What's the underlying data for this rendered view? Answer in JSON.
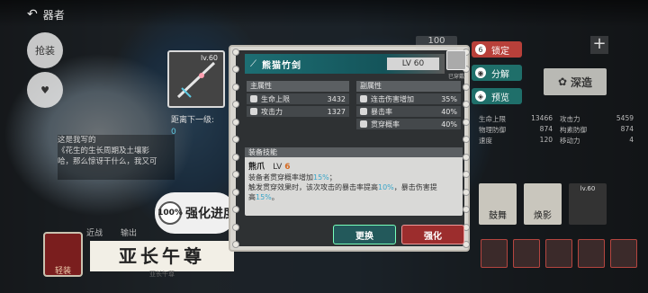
{
  "nav": {
    "back_label": "器者"
  },
  "sidebar": {
    "item1_label": "抢装",
    "item2_label": "装备"
  },
  "bio": {
    "lines": [
      "这是我写的",
      "《花生的生长周期及土壤影",
      "哈，那么惊讶干什么，我又可"
    ]
  },
  "bottom_tabs": [
    "近战",
    "输出"
  ],
  "character": {
    "name": "亚长午尊",
    "subtitle": "亚长午尊",
    "badge_label": "轻装"
  },
  "weapon_card": {
    "level": "lv.60"
  },
  "distance": {
    "label": "距离下一级:",
    "value": "0"
  },
  "enhance_progress": {
    "percent": "100",
    "unit": "%",
    "label": "强化进度"
  },
  "weapon": {
    "name": "熊猫竹剑",
    "level": "LV 60",
    "equipped_label": "已穿戴"
  },
  "main_attrs": {
    "title": "主属性",
    "rows": [
      {
        "label": "生命上限",
        "value": "3432"
      },
      {
        "label": "攻击力",
        "value": "1327"
      }
    ]
  },
  "sub_attrs": {
    "title": "副属性",
    "rows": [
      {
        "label": "连击伤害增加",
        "value": "35%"
      },
      {
        "label": "暴击率",
        "value": "40%"
      },
      {
        "label": "贯穿概率",
        "value": "40%"
      }
    ]
  },
  "skill": {
    "section_title": "装备技能",
    "name": "熊爪",
    "level_prefix": "LV",
    "level": "6",
    "line1a": "装备者贯穿概率增加",
    "line1b": "15%",
    "line1c": "；",
    "line2a": "触发贯穿效果时，该次攻击的暴击率提高",
    "line2b": "10%",
    "line2c": "，暴击伤害提",
    "line3a": "高",
    "line3b": "15%",
    "line3c": "。"
  },
  "buttons": {
    "change": "更换",
    "strengthen": "强化"
  },
  "side_actions": [
    {
      "label": "锁定",
      "icon": "lock-icon",
      "color": "#b8403a"
    },
    {
      "label": "分解",
      "icon": "eye-icon",
      "color": "#1f6f6a"
    },
    {
      "label": "预览",
      "icon": "preview-icon",
      "color": "#1f6f6a"
    }
  ],
  "right": {
    "count": "100",
    "deep_label": "深造",
    "stats": [
      [
        {
          "k": "生命上限",
          "v": "13466"
        },
        {
          "k": "攻击力",
          "v": "5459"
        }
      ],
      [
        {
          "k": "物理防御",
          "v": "874"
        },
        {
          "k": "构素防御",
          "v": "874"
        }
      ],
      [
        {
          "k": "速度",
          "v": "120"
        },
        {
          "k": "移动力",
          "v": "4"
        }
      ]
    ],
    "tiles": [
      "鼓舞",
      "焕影"
    ],
    "tile_level": "lv.60"
  }
}
